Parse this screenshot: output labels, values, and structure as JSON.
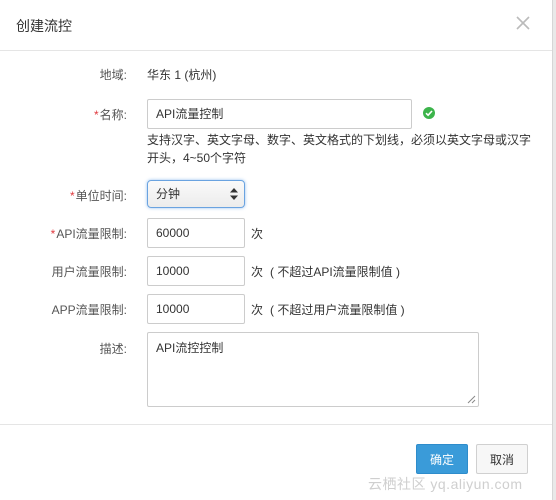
{
  "dialog": {
    "title": "创建流控"
  },
  "form": {
    "region": {
      "label": "地域:",
      "value": "华东 1 (杭州)"
    },
    "name": {
      "required_mark": "*",
      "label": "名称:",
      "value": "API流量控制",
      "hint": "支持汉字、英文字母、数字、英文格式的下划线，必须以英文字母或汉字开头，4~50个字符"
    },
    "time_unit": {
      "required_mark": "*",
      "label": "单位时间:",
      "selected": "分钟"
    },
    "api_limit": {
      "required_mark": "*",
      "label": "API流量限制:",
      "value": "60000",
      "unit": "次"
    },
    "user_limit": {
      "label": "用户流量限制:",
      "value": "10000",
      "unit": "次",
      "note": "( 不超过API流量限制值 )"
    },
    "app_limit": {
      "label": "APP流量限制:",
      "value": "10000",
      "unit": "次",
      "note": "( 不超过用户流量限制值 )"
    },
    "description": {
      "label": "描述:",
      "value": "API流控控制"
    }
  },
  "footer": {
    "confirm_label": "确定",
    "cancel_label": "取消"
  },
  "watermark": "云栖社区 yq.aliyun.com",
  "colors": {
    "primary": "#3a9bd9",
    "required": "#e0393e",
    "success": "#3cb44b"
  }
}
